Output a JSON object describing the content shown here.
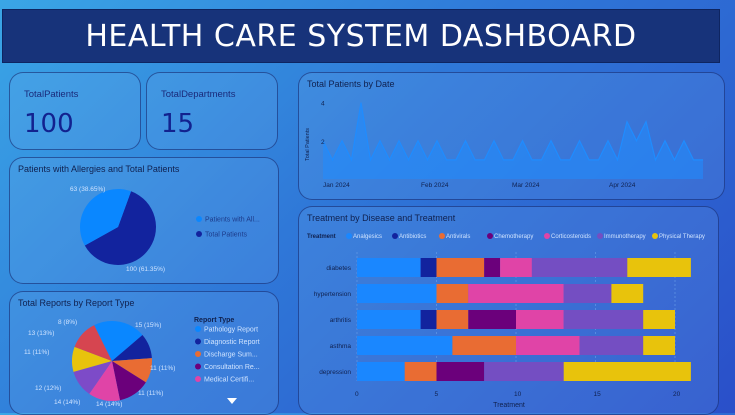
{
  "header": {
    "title": "HEALTH CARE SYSTEM DASHBOARD"
  },
  "kpis": [
    {
      "label": "TotalPatients",
      "value": "100"
    },
    {
      "label": "TotalDepartments",
      "value": "15"
    }
  ],
  "allergy_chart": {
    "title": "Patients with Allergies and Total Patients",
    "legend": [
      "Patients with All...",
      "Total Patients"
    ],
    "colors": [
      "#0a87ff",
      "#12239e"
    ],
    "labels": [
      "63 (38.65%)",
      "100 (61.35%)"
    ]
  },
  "reports_chart": {
    "title": "Total Reports by Report Type",
    "legend_title": "Report Type",
    "legend": [
      "Pathology Report",
      "Diagnostic Report",
      "Discharge Sum...",
      "Consultation Re...",
      "Medical Certifi..."
    ],
    "colors": [
      "#0a87ff",
      "#12239e",
      "#e96c33",
      "#6b007b",
      "#e044a7",
      "#7d4bc8",
      "#e8c30c",
      "#d64550"
    ],
    "slice_labels": [
      "15 (15%)",
      "11 (11%)",
      "11 (11%)",
      "14 (14%)",
      "14 (14%)",
      "12 (12%)",
      "11 (11%)",
      "13 (13%)",
      "8 (8%)"
    ]
  },
  "date_chart": {
    "title": "Total Patients by Date",
    "ylabel": "Total Patients",
    "yticks": [
      "4",
      "2"
    ],
    "xticks": [
      "Jan 2024",
      "Feb 2024",
      "Mar 2024",
      "Apr 2024"
    ],
    "color": "#1f8cff"
  },
  "treatment_chart": {
    "title": "Treatment by Disease and Treatment",
    "legend_title": "Treatment",
    "legend": [
      "Analgesics",
      "Antibiotics",
      "Antivirals",
      "Chemotherapy",
      "Corticosteroids",
      "Immunotherapy",
      "Physical Therapy"
    ],
    "colors": [
      "#1a87ff",
      "#12239e",
      "#e96c33",
      "#6b007b",
      "#e044a7",
      "#744ec2",
      "#e8c30c"
    ],
    "xlabel": "Treatment",
    "xticks": [
      "0",
      "5",
      "10",
      "15",
      "20"
    ]
  },
  "chart_data": [
    {
      "type": "pie",
      "title": "Patients with Allergies and Total Patients",
      "labels": [
        "Patients with Allergies",
        "Total Patients"
      ],
      "values": [
        63,
        100
      ]
    },
    {
      "type": "pie",
      "title": "Total Reports by Report Type",
      "values": [
        15,
        11,
        11,
        14,
        14,
        12,
        11,
        13,
        8
      ]
    },
    {
      "type": "line",
      "title": "Total Patients by Date",
      "ylabel": "Total Patients",
      "ylim": [
        0,
        4.5
      ],
      "x": [
        "2024-01-01",
        "2024-01-04",
        "2024-01-07",
        "2024-01-10",
        "2024-01-13",
        "2024-01-16",
        "2024-01-19",
        "2024-01-22",
        "2024-01-25",
        "2024-01-28",
        "2024-01-31",
        "2024-02-03",
        "2024-02-06",
        "2024-02-09",
        "2024-02-12",
        "2024-02-15",
        "2024-02-18",
        "2024-02-21",
        "2024-02-24",
        "2024-02-27",
        "2024-03-01",
        "2024-03-04",
        "2024-03-07",
        "2024-03-10",
        "2024-03-13",
        "2024-03-16",
        "2024-03-19",
        "2024-03-22",
        "2024-03-25",
        "2024-03-28",
        "2024-03-31",
        "2024-04-03",
        "2024-04-06",
        "2024-04-09",
        "2024-04-12",
        "2024-04-15",
        "2024-04-18",
        "2024-04-21",
        "2024-04-24",
        "2024-04-27",
        "2024-04-30"
      ],
      "values": [
        2,
        1,
        2,
        1,
        4,
        1,
        2,
        1,
        2,
        1,
        2,
        1,
        2,
        1,
        1,
        2,
        1,
        1,
        2,
        1,
        1,
        2,
        1,
        1,
        2,
        1,
        1,
        2,
        1,
        1,
        2,
        1,
        3,
        2,
        3,
        1,
        2,
        1,
        2,
        1,
        1
      ]
    },
    {
      "type": "bar",
      "title": "Treatment by Disease and Treatment",
      "xlabel": "Treatment",
      "xlim": [
        0,
        21
      ],
      "categories": [
        "diabetes",
        "hypertension",
        "arthritis",
        "asthma",
        "depression"
      ],
      "series": [
        {
          "name": "Analgesics",
          "values": [
            4,
            5,
            4,
            6,
            3
          ]
        },
        {
          "name": "Antibiotics",
          "values": [
            1,
            0,
            1,
            0,
            0
          ]
        },
        {
          "name": "Antivirals",
          "values": [
            3,
            2,
            2,
            4,
            2
          ]
        },
        {
          "name": "Chemotherapy",
          "values": [
            1,
            0,
            3,
            0,
            3
          ]
        },
        {
          "name": "Corticosteroids",
          "values": [
            2,
            6,
            3,
            4,
            0
          ]
        },
        {
          "name": "Immunotherapy",
          "values": [
            6,
            3,
            5,
            4,
            5
          ]
        },
        {
          "name": "Physical Therapy",
          "values": [
            4,
            2,
            2,
            2,
            8
          ]
        }
      ]
    }
  ]
}
